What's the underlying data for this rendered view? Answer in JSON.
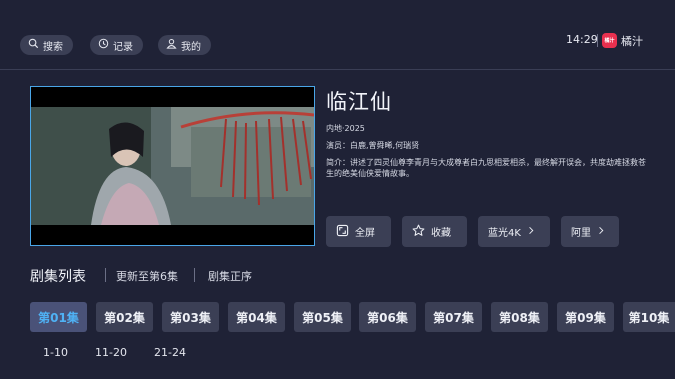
{
  "header": {
    "search_label": "搜索",
    "history_label": "记录",
    "profile_label": "我的",
    "clock": "14:29",
    "brand_logo_text": "橘汁",
    "brand_name": "橘汁"
  },
  "show": {
    "title": "临江仙",
    "meta": "内地·2025",
    "cast": "演员：白鹿,曾舜晞,何瑞贤",
    "synopsis": "简介：讲述了四灵仙尊李青月与大成尊者白九思相爱相杀，最终解开误会，共度劫难拯救苍生的绝美仙侠爱情故事。"
  },
  "actions": {
    "fullscreen_label": "全屏",
    "favorite_label": "收藏",
    "quality_label": "蓝光4K",
    "source_label": "阿里"
  },
  "episodes": {
    "section_title": "剧集列表",
    "update_status": "更新至第6集",
    "order_label": "剧集正序",
    "items": [
      "第01集",
      "第02集",
      "第03集",
      "第04集",
      "第05集",
      "第06集",
      "第07集",
      "第08集",
      "第09集",
      "第10集"
    ],
    "ranges": [
      "1-10",
      "11-20",
      "21-24"
    ]
  },
  "colors": {
    "background": "#1f2236",
    "pill": "#3b3f55",
    "accent": "#4fb2f5",
    "brand": "#e8304f"
  }
}
